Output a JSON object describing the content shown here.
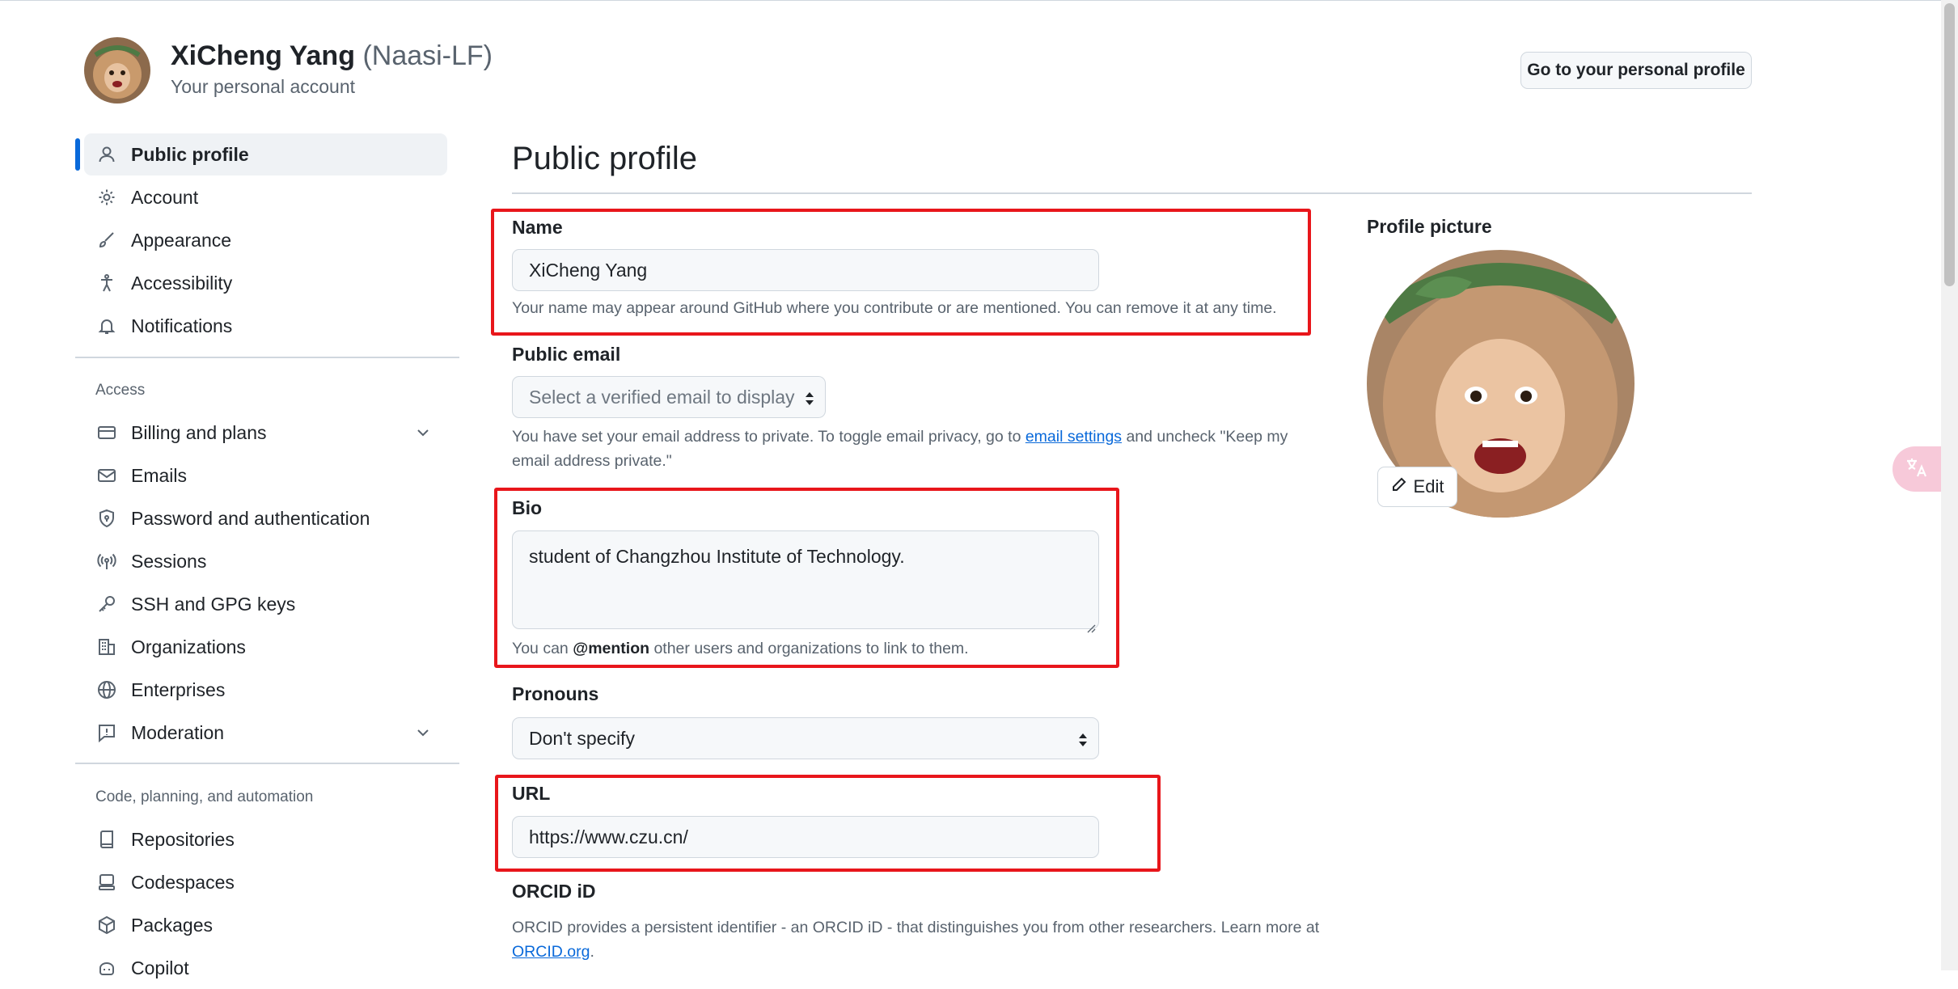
{
  "header": {
    "name": "XiCheng Yang",
    "handle": "(Naasi-LF)",
    "subtitle": "Your personal account",
    "profile_button": "Go to your personal profile"
  },
  "sidebar": {
    "items": [
      {
        "label": "Public profile",
        "icon": "person-icon",
        "active": true
      },
      {
        "label": "Account",
        "icon": "gear-icon"
      },
      {
        "label": "Appearance",
        "icon": "paintbrush-icon"
      },
      {
        "label": "Accessibility",
        "icon": "accessibility-icon"
      },
      {
        "label": "Notifications",
        "icon": "bell-icon"
      }
    ],
    "access_title": "Access",
    "access_items": [
      {
        "label": "Billing and plans",
        "icon": "credit-card-icon",
        "expandable": true
      },
      {
        "label": "Emails",
        "icon": "mail-icon"
      },
      {
        "label": "Password and authentication",
        "icon": "shield-lock-icon"
      },
      {
        "label": "Sessions",
        "icon": "broadcast-icon"
      },
      {
        "label": "SSH and GPG keys",
        "icon": "key-icon"
      },
      {
        "label": "Organizations",
        "icon": "organization-icon"
      },
      {
        "label": "Enterprises",
        "icon": "globe-icon"
      },
      {
        "label": "Moderation",
        "icon": "report-icon",
        "expandable": true
      }
    ],
    "code_title": "Code, planning, and automation",
    "code_items": [
      {
        "label": "Repositories",
        "icon": "repo-icon"
      },
      {
        "label": "Codespaces",
        "icon": "codespaces-icon"
      },
      {
        "label": "Packages",
        "icon": "package-icon"
      },
      {
        "label": "Copilot",
        "icon": "copilot-icon"
      }
    ]
  },
  "main": {
    "title": "Public profile",
    "name_label": "Name",
    "name_value": "XiCheng Yang",
    "name_note": "Your name may appear around GitHub where you contribute or are mentioned. You can remove it at any time.",
    "email_label": "Public email",
    "email_select": "Select a verified email to display",
    "email_note_1": "You have set your email address to private. To toggle email privacy, go to ",
    "email_note_link": "email settings",
    "email_note_2": " and uncheck \"Keep my",
    "email_note_3": "email address private.\"",
    "bio_label": "Bio",
    "bio_value": "student of Changzhou Institute of Technology.",
    "bio_note_1": "You can ",
    "bio_note_mention": "@mention",
    "bio_note_2": " other users and organizations to link to them.",
    "pronouns_label": "Pronouns",
    "pronouns_value": "Don't specify",
    "url_label": "URL",
    "url_value": "https://www.czu.cn/",
    "orcid_label": "ORCID iD",
    "orcid_note": "ORCID provides a persistent identifier - an ORCID iD - that distinguishes you from other researchers. Learn more at",
    "orcid_link": "ORCID.org",
    "orcid_period": "."
  },
  "profile_picture": {
    "label": "Profile picture",
    "edit_label": "Edit"
  },
  "colors": {
    "accent": "#0969da",
    "highlight": "#e8161b",
    "muted": "#59636e"
  }
}
